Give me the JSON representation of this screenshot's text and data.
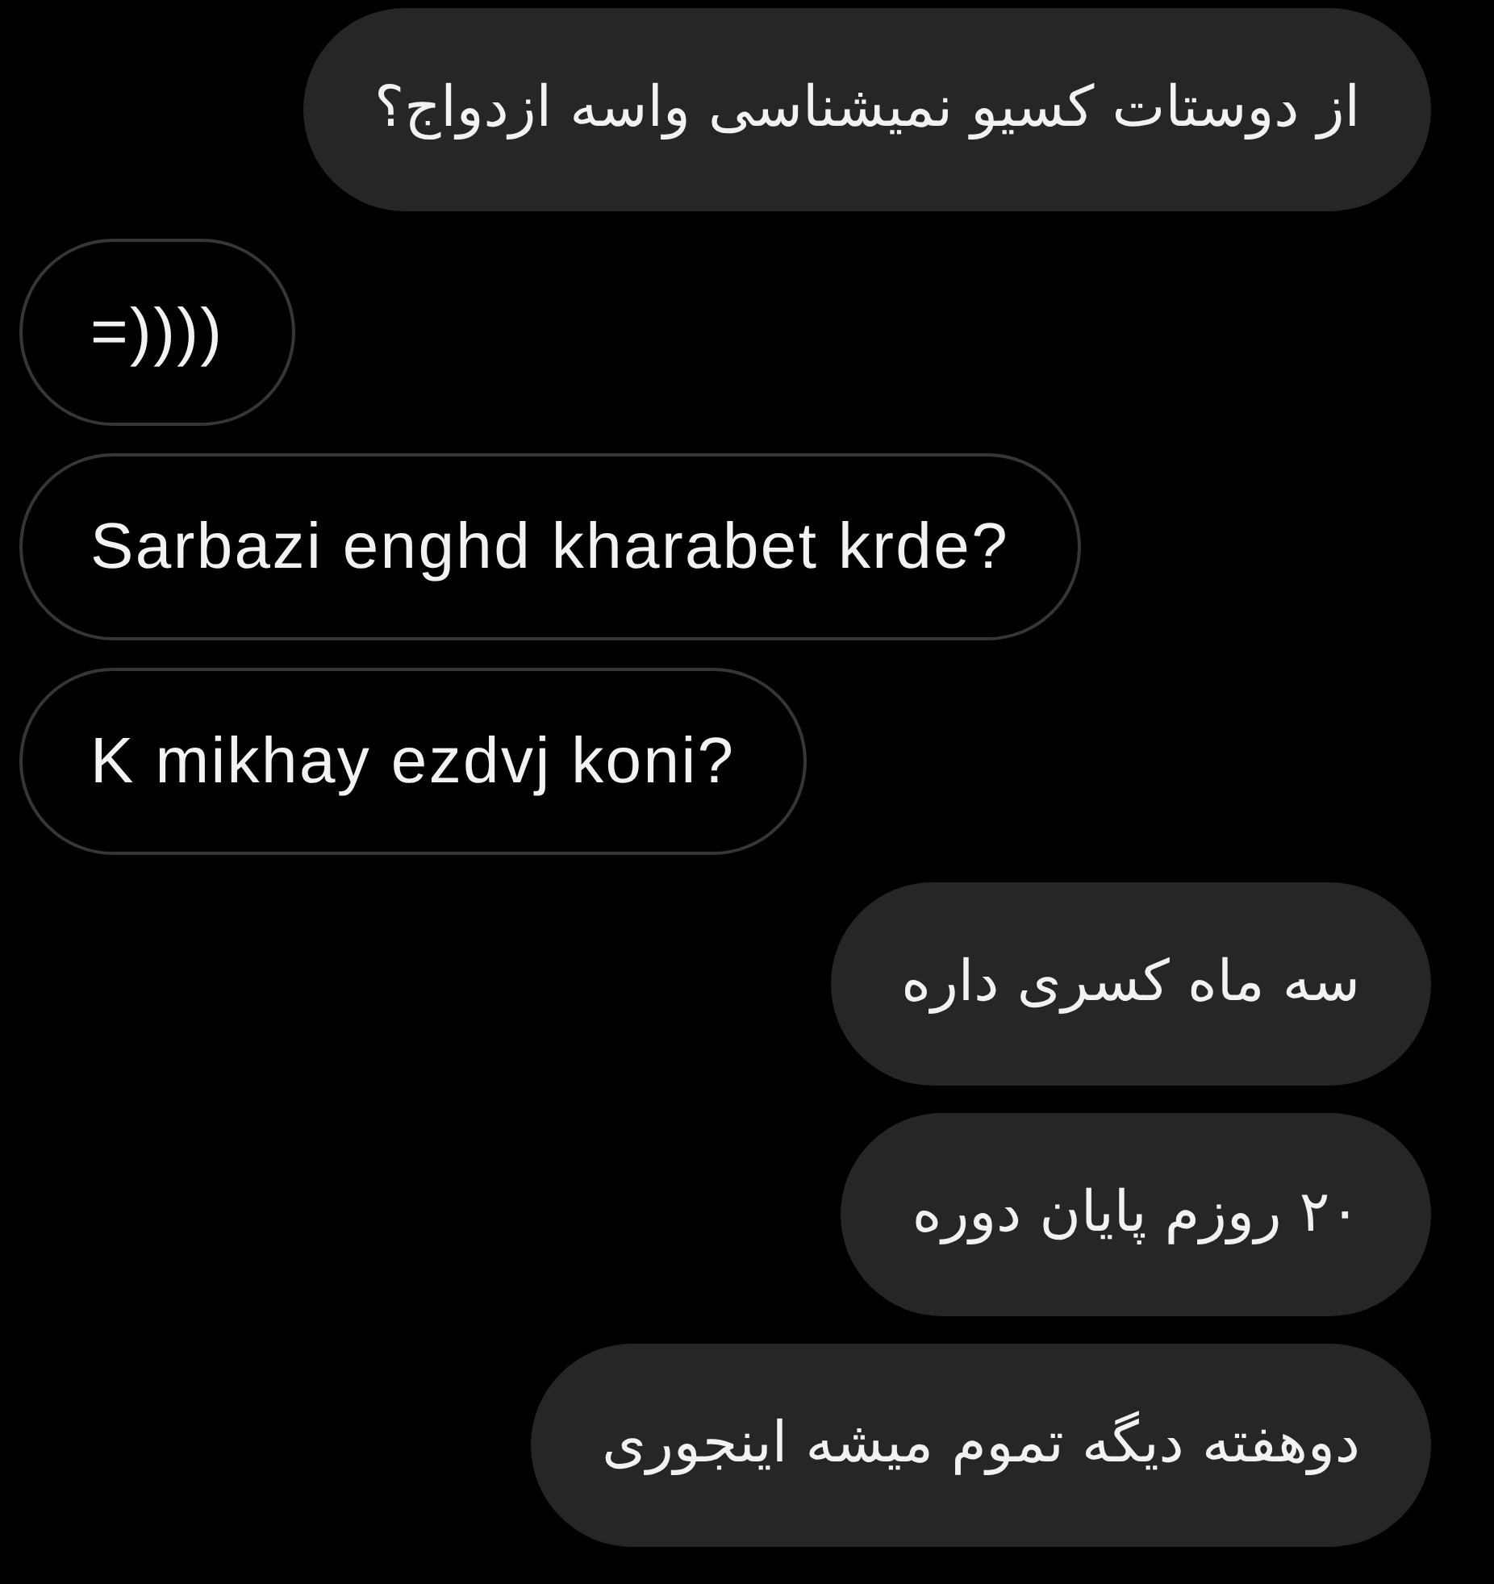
{
  "messages": [
    {
      "kind": "sent",
      "text": "از دوستات کسیو نمیشناسی واسه ازدواج؟"
    },
    {
      "kind": "received",
      "text": "=))))"
    },
    {
      "kind": "received",
      "text": "Sarbazi enghd kharabet krde?"
    },
    {
      "kind": "received",
      "text": "K mikhay ezdvj koni?"
    },
    {
      "kind": "sent",
      "text": "سه ماه کسری داره"
    },
    {
      "kind": "sent",
      "text": "۲۰ روزم پایان دوره"
    },
    {
      "kind": "sent",
      "text": "دوهفته دیگه تموم میشه اینجوری"
    }
  ]
}
